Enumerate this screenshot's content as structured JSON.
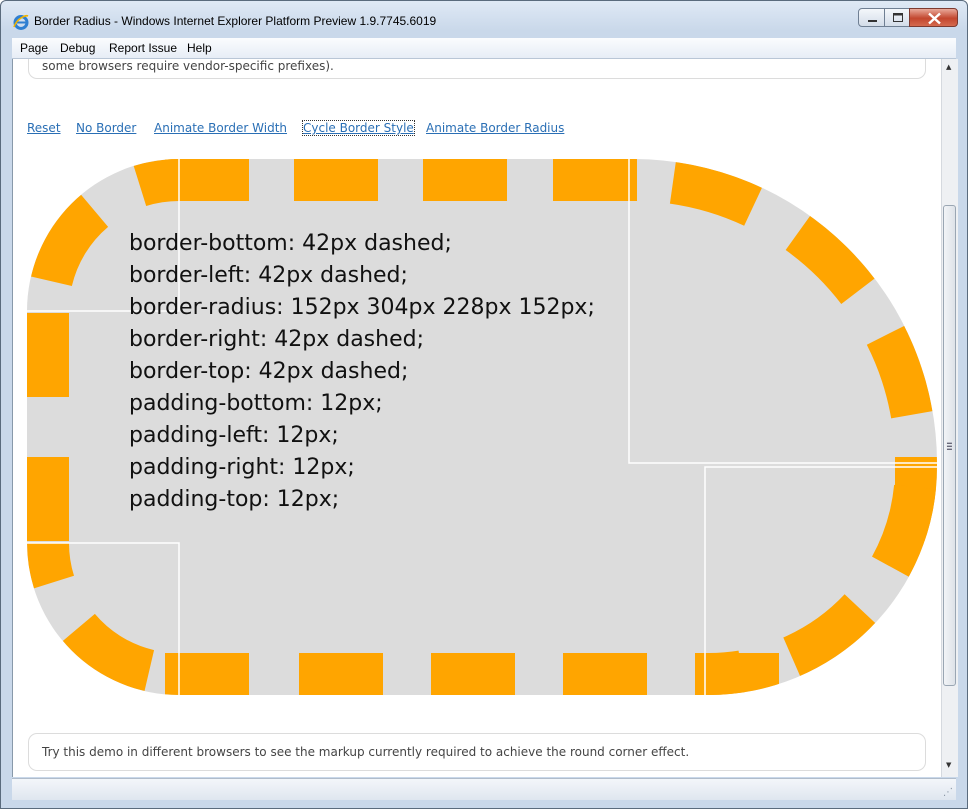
{
  "window": {
    "title": "Border Radius - Windows Internet Explorer Platform Preview 1.9.7745.6019"
  },
  "menu": {
    "items": [
      {
        "label": "Page"
      },
      {
        "label": "Debug"
      },
      {
        "label": "Report Issue"
      },
      {
        "label": "Help"
      }
    ]
  },
  "page": {
    "top_note": "some browsers require vendor-specific prefixes).",
    "links": [
      {
        "label": "Reset"
      },
      {
        "label": "No Border"
      },
      {
        "label": "Animate Border Width"
      },
      {
        "label": "Cycle Border Style"
      },
      {
        "label": "Animate Border Radius"
      }
    ],
    "css_lines": [
      "border-bottom: 42px dashed;",
      "border-left: 42px dashed;",
      "border-radius: 152px 304px 228px 152px;",
      "border-right: 42px dashed;",
      "border-top: 42px dashed;",
      "padding-bottom: 12px;",
      "padding-left: 12px;",
      "padding-right: 12px;",
      "padding-top: 12px;"
    ],
    "bottom_note": "Try this demo in different browsers to see the markup currently required to achieve the round corner effect."
  },
  "colors": {
    "border": "#FFA500",
    "fill": "#DCDCDC",
    "link": "#2A6FB5",
    "guide": "#FFFFFF"
  },
  "icons": {
    "app": "ie-logo-icon",
    "minimize": "minimize-icon",
    "maximize": "maximize-icon",
    "close": "close-icon",
    "scroll_up": "scroll-up-icon",
    "scroll_down": "scroll-down-icon",
    "size_grip": "size-grip-icon"
  }
}
